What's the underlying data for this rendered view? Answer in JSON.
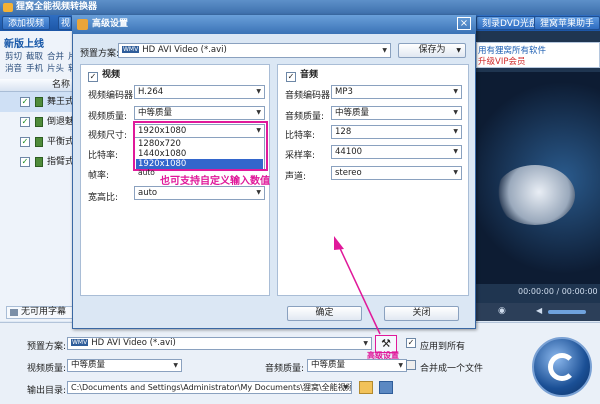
{
  "window": {
    "title": "狸窝全能视频转换器"
  },
  "toolbar": {
    "add_video": "添加视频",
    "add_partial": "视",
    "right1": "刻录DVD光盘",
    "right2": "狸窝苹果助手"
  },
  "left": {
    "new_online": "新版上线",
    "tools_row1": [
      "剪切",
      "截取",
      "合并",
      "片"
    ],
    "tools_row2": [
      "消音",
      "手机",
      "片头",
      "软"
    ],
    "column_name": "名称",
    "files": [
      {
        "name": "舞王式风",
        "checked": true,
        "selected": true
      },
      {
        "name": "倒退魅",
        "checked": true,
        "selected": false
      },
      {
        "name": "平衡式风",
        "checked": true,
        "selected": false
      },
      {
        "name": "指臂式风",
        "checked": true,
        "selected": false
      }
    ],
    "subtitle": "无可用字幕"
  },
  "right": {
    "promo1": "用有狸窝所有软件",
    "promo2": "升级VIP会员",
    "timecode": "00:00:00 / 00:00:00"
  },
  "bottom": {
    "preset_label": "预置方案:",
    "preset_value": "HD AVI Video (*.avi)",
    "apply_all": "应用到所有",
    "video_quality_label": "视频质量:",
    "video_quality": "中等质量",
    "audio_quality_label": "音频质量:",
    "audio_quality": "中等质量",
    "merge_label": "合并成一个文件",
    "output_label": "输出目录:",
    "output_path": "C:\\Documents and Settings\\Administrator\\My Documents\\狸窝\\全能视频..."
  },
  "dialog": {
    "title": "高级设置",
    "close": "×",
    "preset_label": "预置方案:",
    "preset_value": "HD AVI Video (*.avi)",
    "save_as": "保存为",
    "video": {
      "header": "视频",
      "codec_label": "视频编码器:",
      "codec": "H.264",
      "quality_label": "视频质量:",
      "quality": "中等质量",
      "size_label": "视频尺寸:",
      "size": "1920x1080",
      "size_options": [
        "1280x720",
        "1440x1080",
        "1920x1080"
      ],
      "bitrate_label": "比特率:",
      "bitrate": "auto",
      "fps_label": "帧率:",
      "aspect_label": "宽高比:",
      "aspect": "auto"
    },
    "audio": {
      "header": "音频",
      "codec_label": "音频编码器:",
      "codec": "MP3",
      "quality_label": "音频质量:",
      "quality": "中等质量",
      "bitrate_label": "比特率:",
      "bitrate": "128",
      "samplerate_label": "采样率:",
      "samplerate": "44100",
      "channel_label": "声道:",
      "channel": "stereo"
    },
    "ok": "确定",
    "close_btn": "关闭"
  },
  "annotations": {
    "custom_input": "也可支持自定义输入数值",
    "advanced": "高级设置"
  },
  "colors": {
    "annotation": "#e0199a",
    "title_blue": "#3a72b5"
  }
}
